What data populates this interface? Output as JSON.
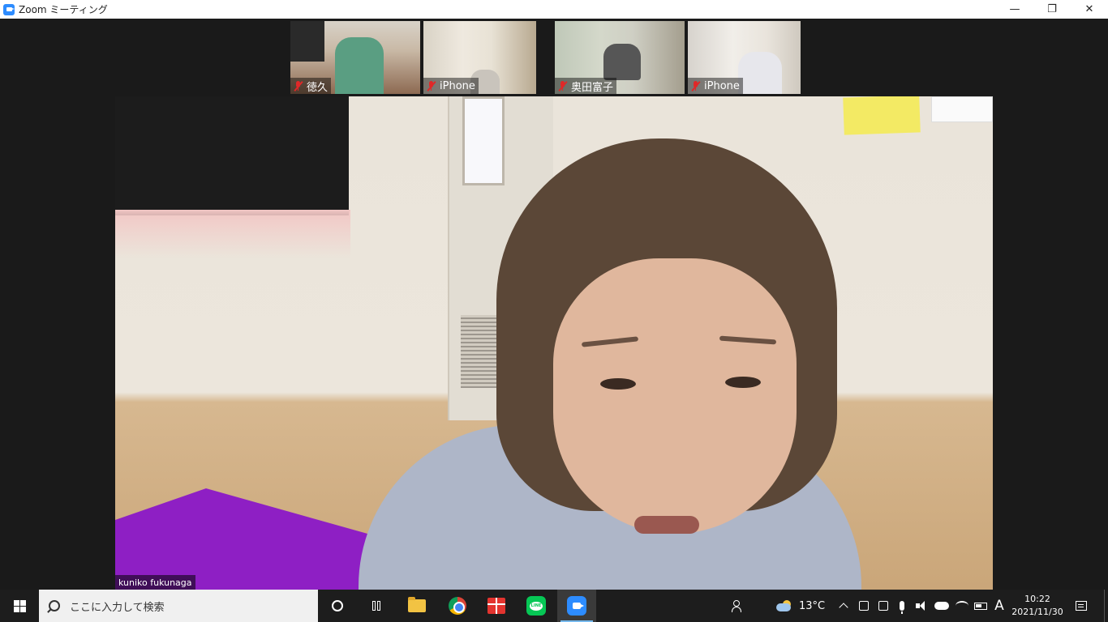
{
  "window": {
    "title": "Zoom ミーティング",
    "controls": {
      "minimize": "—",
      "maximize": "❐",
      "close": "✕"
    }
  },
  "participants": [
    {
      "name": "徳久",
      "muted": true
    },
    {
      "name": "iPhone",
      "muted": true
    },
    {
      "name": "奥田富子",
      "muted": true
    },
    {
      "name": "iPhone",
      "muted": true
    }
  ],
  "active_speaker": {
    "name": "kuniko fukunaga"
  },
  "taskbar": {
    "search_placeholder": "ここに入力して検索",
    "pinned_apps": [
      "cortana",
      "task-view",
      "file-explorer",
      "chrome",
      "gift-app",
      "line",
      "zoom"
    ],
    "active_app": "zoom",
    "weather": "13°C",
    "ime": "A",
    "time": "10:22",
    "date": "2021/11/30"
  }
}
